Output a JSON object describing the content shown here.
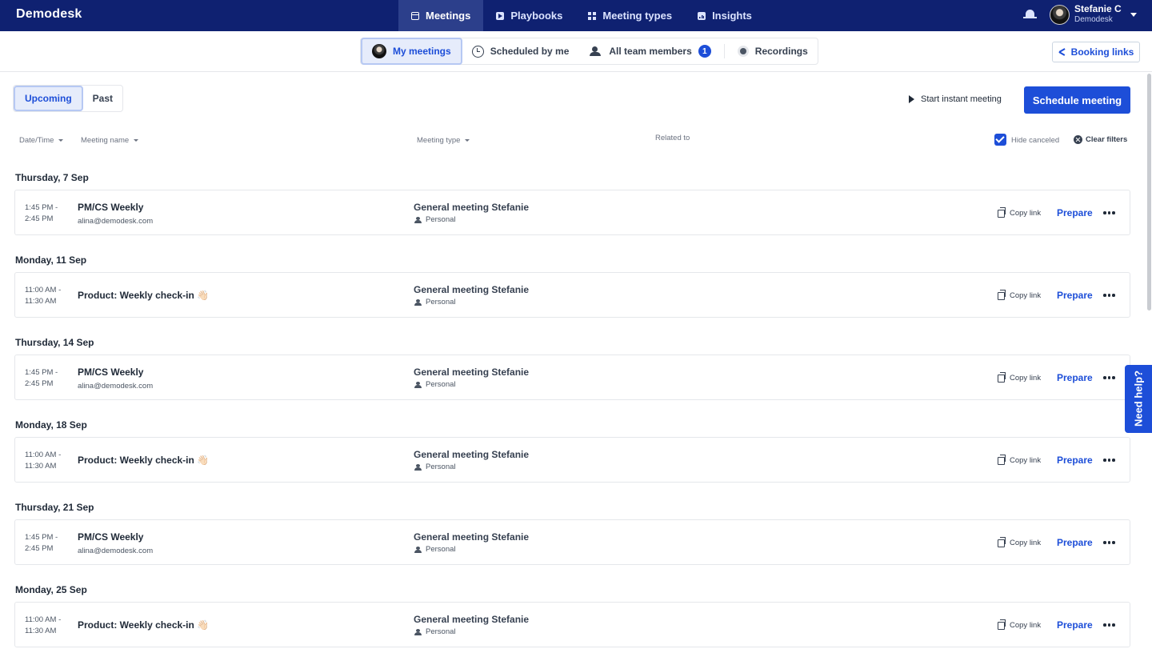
{
  "app": {
    "logo": "Demodesk"
  },
  "nav": {
    "tabs": [
      {
        "label": "Meetings",
        "icon": "calendar-icon",
        "active": true
      },
      {
        "label": "Playbooks",
        "icon": "playbook-icon"
      },
      {
        "label": "Meeting types",
        "icon": "grid-icon"
      },
      {
        "label": "Insights",
        "icon": "chart-icon"
      }
    ]
  },
  "user": {
    "name": "Stefanie C",
    "org": "Demodesk"
  },
  "subnav": {
    "my_meetings": "My meetings",
    "scheduled_by_me": "Scheduled by me",
    "all_team_members": "All team members",
    "team_badge": "1",
    "recordings": "Recordings",
    "booking_links": "Booking links"
  },
  "filters": {
    "upcoming": "Upcoming",
    "past": "Past",
    "start_instant": "Start instant meeting",
    "schedule": "Schedule meeting",
    "col_datetime": "Date/Time",
    "col_meeting_name": "Meeting name",
    "col_meeting_type": "Meeting type",
    "col_related_to": "Related to",
    "hide_canceled": "Hide canceled",
    "clear_filters": "Clear filters"
  },
  "days": [
    {
      "label": "Thursday, 7 Sep",
      "meeting": {
        "start": "1:45 PM -",
        "end": "2:45 PM",
        "name": "PM/CS Weekly",
        "email": "alina@demodesk.com",
        "type": "General meeting Stefanie",
        "tag": "Personal",
        "copy": "Copy link",
        "prepare": "Prepare"
      }
    },
    {
      "label": "Monday, 11 Sep",
      "meeting": {
        "start": "11:00 AM -",
        "end": "11:30 AM",
        "name": "Product: Weekly check-in 👋🏻",
        "email": "",
        "type": "General meeting Stefanie",
        "tag": "Personal",
        "copy": "Copy link",
        "prepare": "Prepare"
      }
    },
    {
      "label": "Thursday, 14 Sep",
      "meeting": {
        "start": "1:45 PM -",
        "end": "2:45 PM",
        "name": "PM/CS Weekly",
        "email": "alina@demodesk.com",
        "type": "General meeting Stefanie",
        "tag": "Personal",
        "copy": "Copy link",
        "prepare": "Prepare"
      }
    },
    {
      "label": "Monday, 18 Sep",
      "meeting": {
        "start": "11:00 AM -",
        "end": "11:30 AM",
        "name": "Product: Weekly check-in 👋🏻",
        "email": "",
        "type": "General meeting Stefanie",
        "tag": "Personal",
        "copy": "Copy link",
        "prepare": "Prepare"
      }
    },
    {
      "label": "Thursday, 21 Sep",
      "meeting": {
        "start": "1:45 PM -",
        "end": "2:45 PM",
        "name": "PM/CS Weekly",
        "email": "alina@demodesk.com",
        "type": "General meeting Stefanie",
        "tag": "Personal",
        "copy": "Copy link",
        "prepare": "Prepare"
      }
    },
    {
      "label": "Monday, 25 Sep",
      "meeting": {
        "start": "11:00 AM -",
        "end": "11:30 AM",
        "name": "Product: Weekly check-in 👋🏻",
        "email": "",
        "type": "General meeting Stefanie",
        "tag": "Personal",
        "copy": "Copy link",
        "prepare": "Prepare"
      }
    }
  ],
  "help": {
    "label": "Need help?"
  }
}
